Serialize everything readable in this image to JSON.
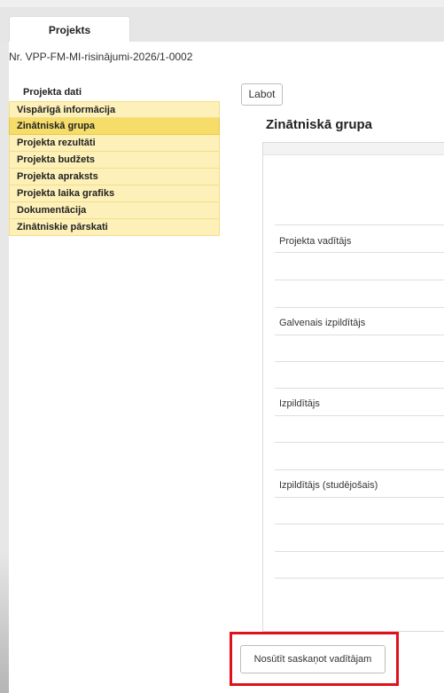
{
  "tabs": [
    {
      "label": "Projekts"
    }
  ],
  "project": {
    "number": "Nr. VPP-FM-MI-risinājumi-2026/1-0002"
  },
  "sidebar": {
    "heading": "Projekta dati",
    "items": [
      {
        "label": "Vispārīgā informācija"
      },
      {
        "label": "Zinātniskā grupa"
      },
      {
        "label": "Projekta rezultāti"
      },
      {
        "label": "Projekta budžets"
      },
      {
        "label": "Projekta apraksts"
      },
      {
        "label": "Projekta laika grafiks"
      },
      {
        "label": "Dokumentācija"
      },
      {
        "label": "Zinātniskie pārskati"
      }
    ],
    "active": "Zinātniskā grupa"
  },
  "main": {
    "edit_label": "Labot",
    "section_title": "Zinātniskā grupa",
    "roles": [
      {
        "label": "Projekta vadītājs"
      },
      {
        "label": "Galvenais izpildītājs"
      },
      {
        "label": "Izpildītājs"
      },
      {
        "label": "Izpildītājs (studējošais)"
      }
    ],
    "send_label": "Nosūtīt saskaņot vadītājam"
  },
  "colors": {
    "nav_bg": "#fdf0b8",
    "nav_active_bg": "#f6dd6a",
    "highlight": "#e0111a"
  }
}
